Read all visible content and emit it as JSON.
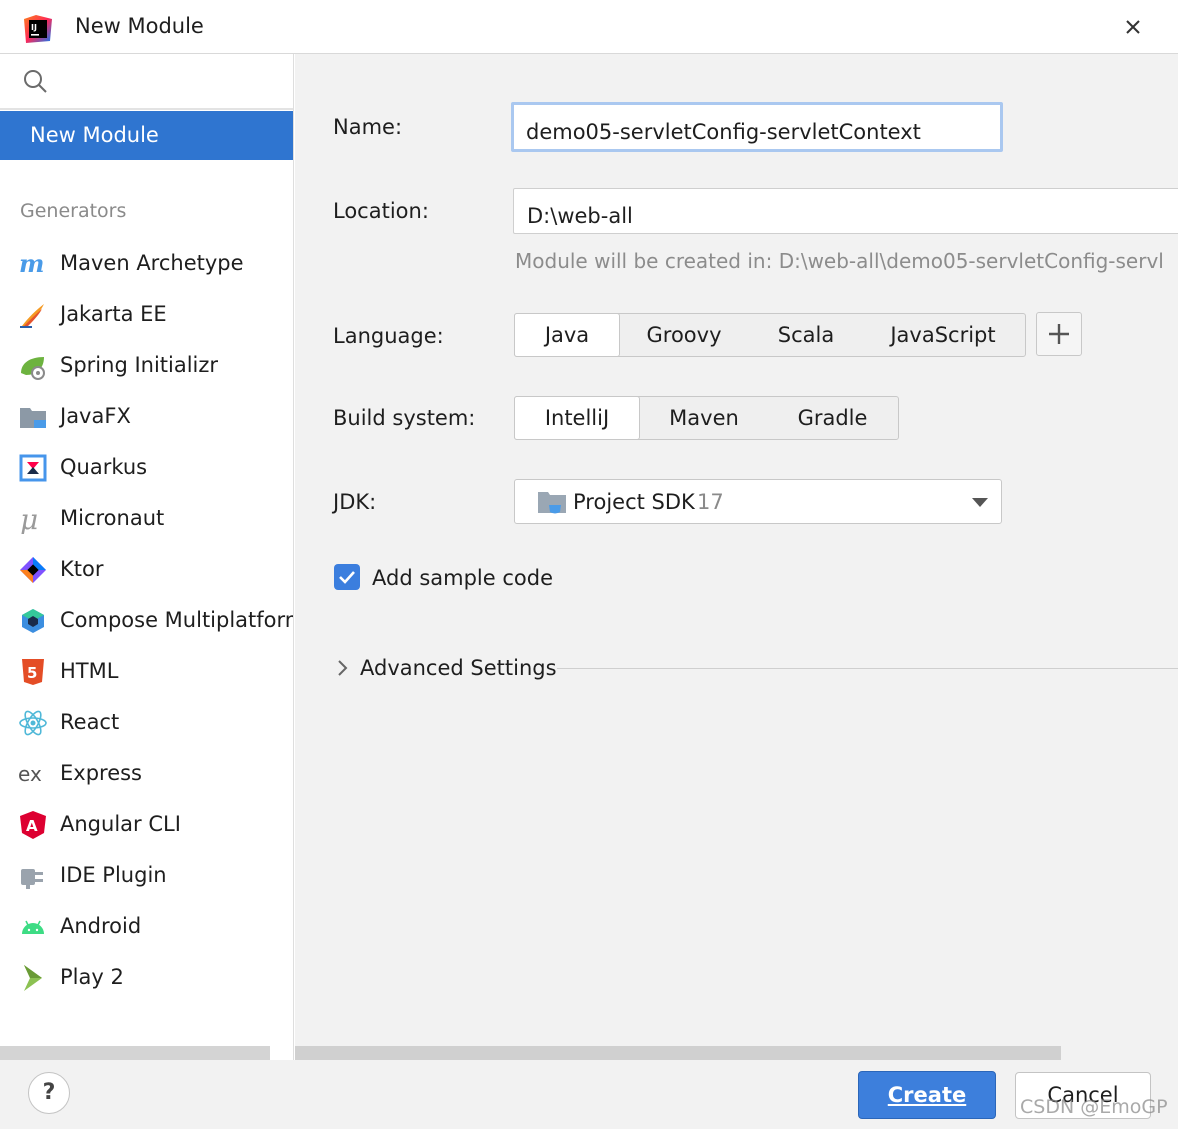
{
  "window": {
    "title": "New Module"
  },
  "sidebar": {
    "selected": "New Module",
    "generators_heading": "Generators",
    "generators": [
      {
        "label": "Maven Archetype",
        "icon": "maven-icon"
      },
      {
        "label": "Jakarta EE",
        "icon": "jakarta-ee-icon"
      },
      {
        "label": "Spring Initializr",
        "icon": "spring-icon"
      },
      {
        "label": "JavaFX",
        "icon": "javafx-icon"
      },
      {
        "label": "Quarkus",
        "icon": "quarkus-icon"
      },
      {
        "label": "Micronaut",
        "icon": "micronaut-icon"
      },
      {
        "label": "Ktor",
        "icon": "ktor-icon"
      },
      {
        "label": "Compose Multiplatform",
        "icon": "compose-icon"
      },
      {
        "label": "HTML",
        "icon": "html5-icon"
      },
      {
        "label": "React",
        "icon": "react-icon"
      },
      {
        "label": "Express",
        "icon": "express-icon"
      },
      {
        "label": "Angular CLI",
        "icon": "angular-icon"
      },
      {
        "label": "IDE Plugin",
        "icon": "plugin-icon"
      },
      {
        "label": "Android",
        "icon": "android-icon"
      },
      {
        "label": "Play 2",
        "icon": "play-icon"
      }
    ]
  },
  "form": {
    "name_label": "Name:",
    "name_value": "demo05-servletConfig-servletContext",
    "location_label": "Location:",
    "location_value": "D:\\web-all",
    "location_hint": "Module will be created in: D:\\web-all\\demo05-servletConfig-servl",
    "language_label": "Language:",
    "languages": [
      "Java",
      "Groovy",
      "Scala",
      "JavaScript"
    ],
    "language_selected": "Java",
    "build_label": "Build system:",
    "build_systems": [
      "IntelliJ",
      "Maven",
      "Gradle"
    ],
    "build_selected": "IntelliJ",
    "jdk_label": "JDK:",
    "jdk_value": "Project SDK",
    "jdk_version": "17",
    "sample_code_label": "Add sample code",
    "sample_code_checked": true,
    "advanced_label": "Advanced Settings"
  },
  "footer": {
    "help_label": "?",
    "create_label": "Create",
    "cancel_label": "Cancel"
  },
  "watermark": "CSDN @EmoGP",
  "colors": {
    "accent": "#2f75d0",
    "button_primary": "#3d7fdc",
    "panel_bg": "#f2f2f2",
    "focus_border": "#aac8f0"
  }
}
